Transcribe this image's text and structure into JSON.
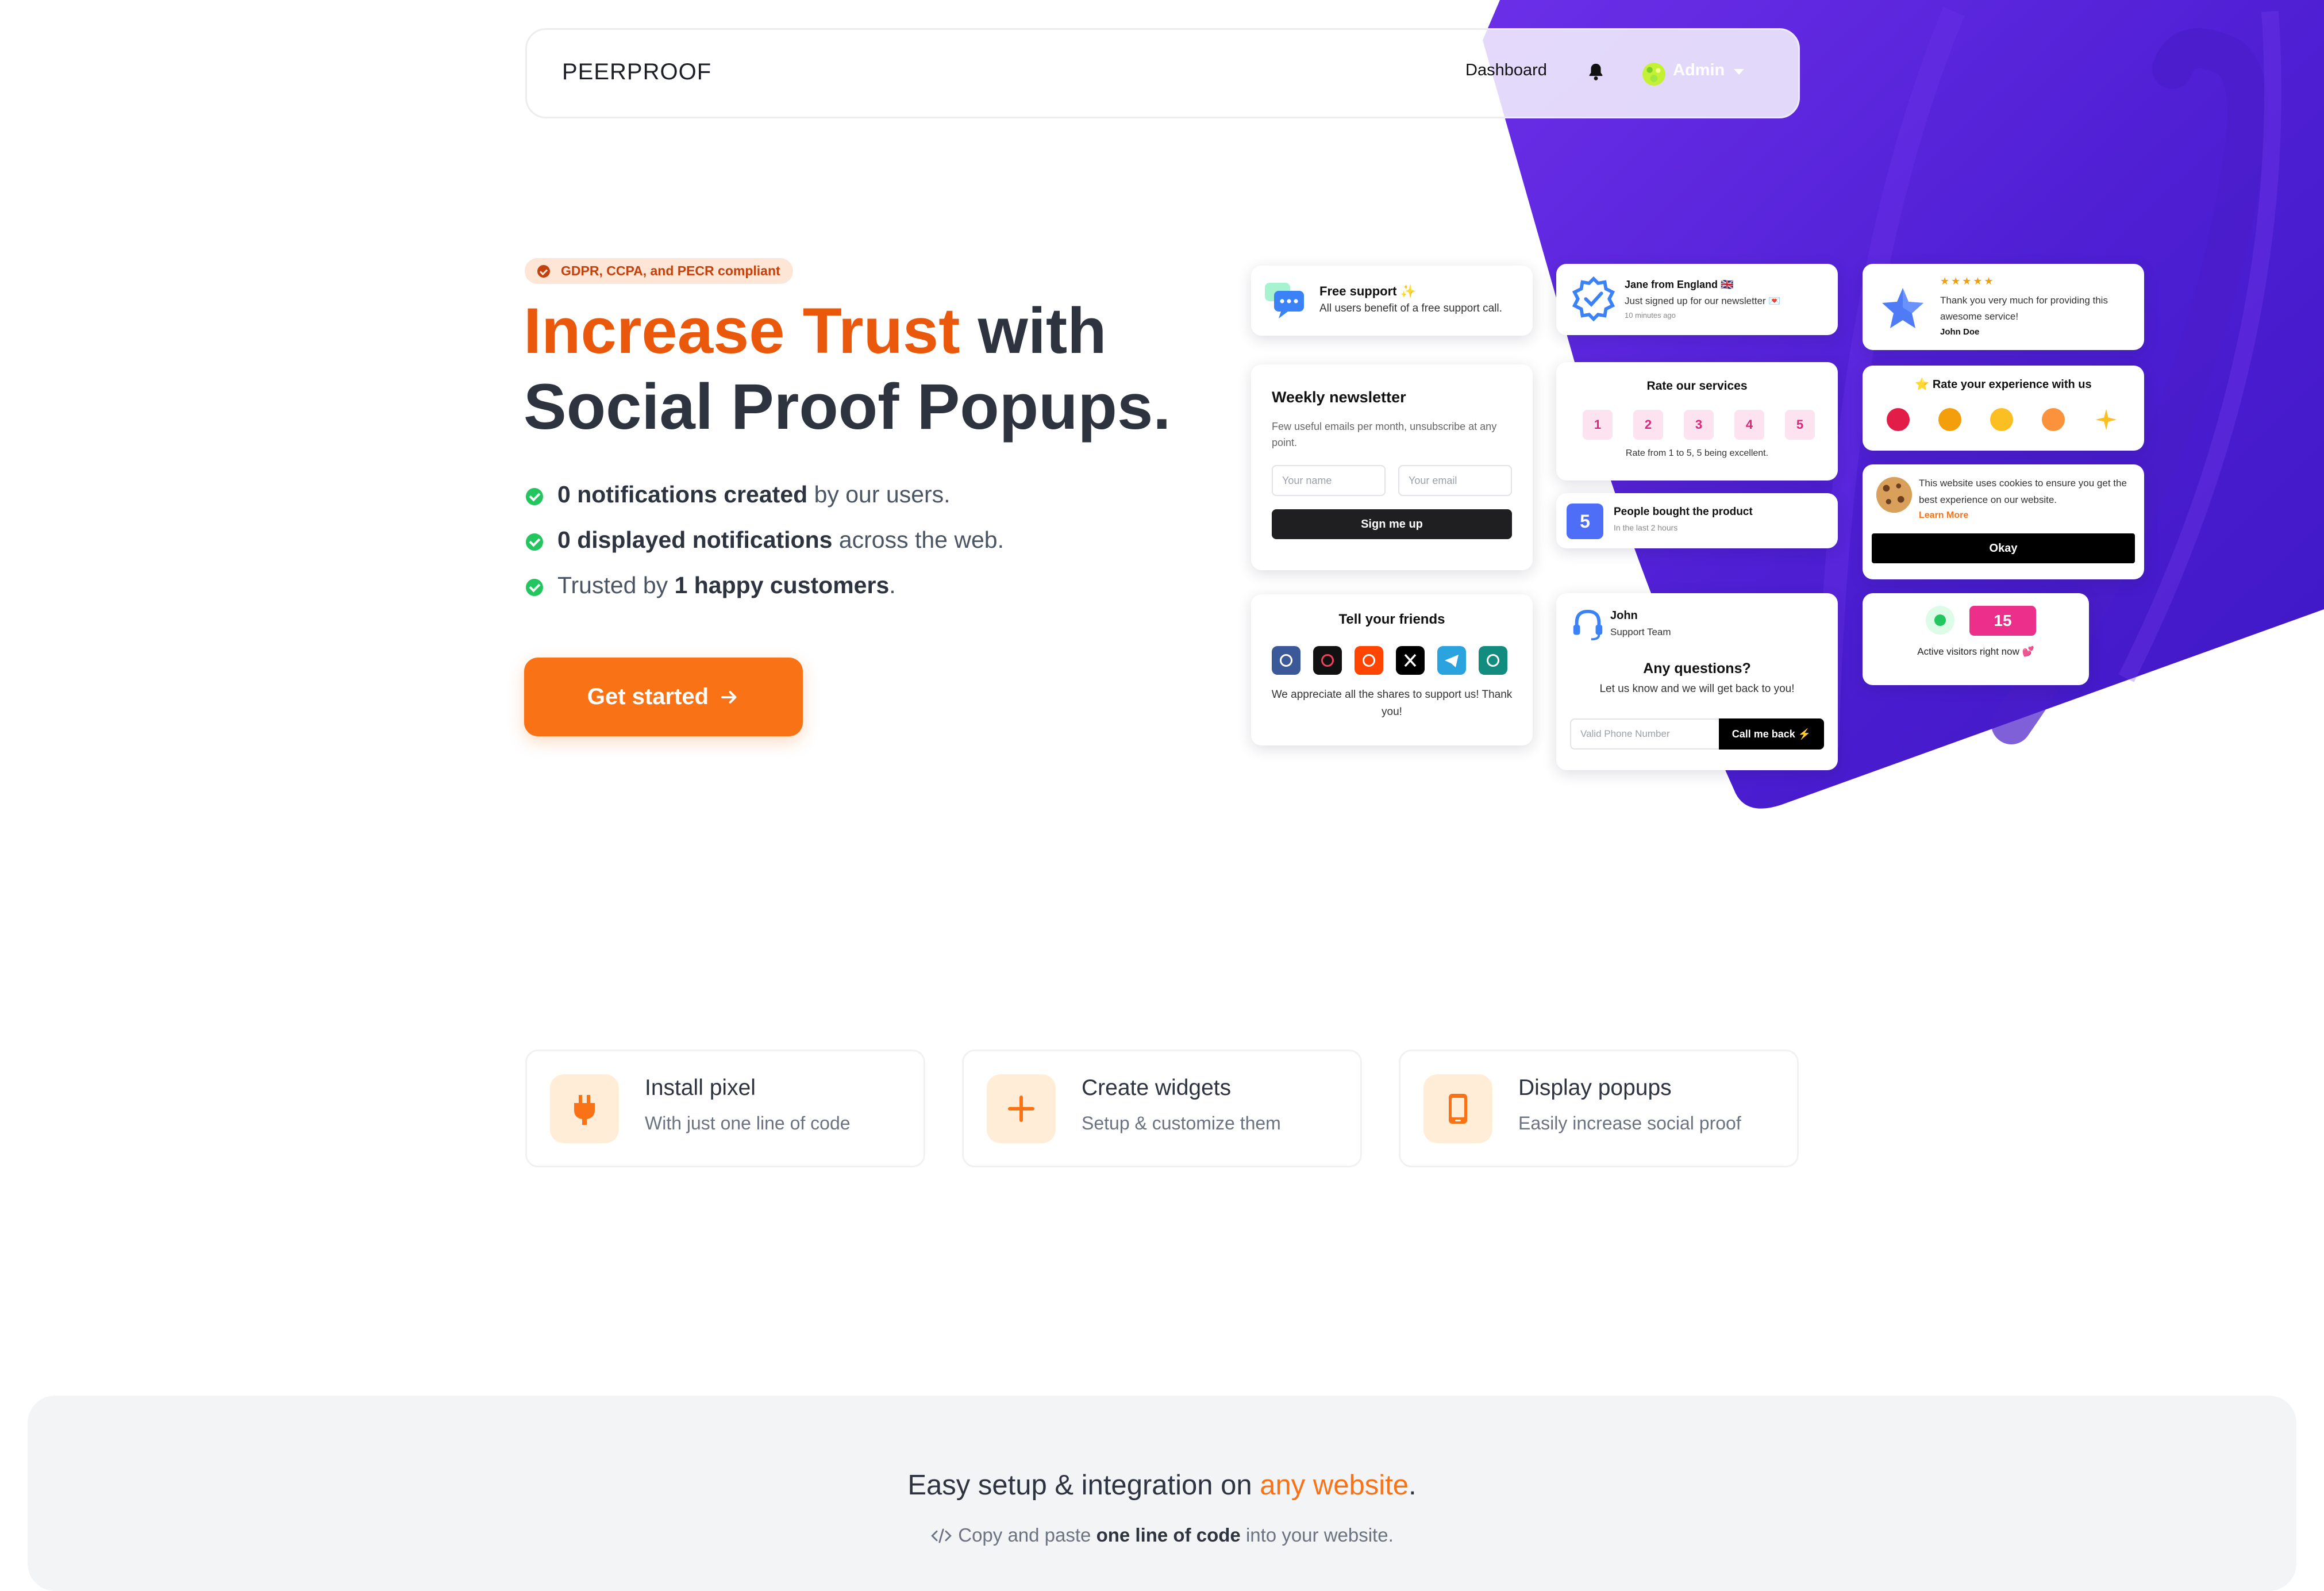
{
  "nav": {
    "brand": "PEERPROOF",
    "dashboard": "Dashboard",
    "admin": "Admin"
  },
  "hero": {
    "badge": "GDPR, CCPA, and PECR compliant",
    "title_accent": "Increase Trust",
    "title_rest_1": " with",
    "title_line_2": "Social Proof Popups.",
    "features": [
      {
        "bold": "0 notifications created",
        "rest": " by our users."
      },
      {
        "bold": "0 displayed notifications",
        "rest": " across the web."
      },
      {
        "pre": "Trusted by ",
        "bold": "1 happy customers",
        "rest": "."
      }
    ],
    "cta": "Get started"
  },
  "popups": {
    "free_support": {
      "title": "Free support ✨",
      "text": "All users benefit of a free support call."
    },
    "newsletter": {
      "title": "Weekly newsletter",
      "text": "Few useful emails per month, unsubscribe at any point.",
      "name_placeholder": "Your name",
      "email_placeholder": "Your email",
      "button": "Sign me up"
    },
    "tell_friends": {
      "title": "Tell your friends",
      "text": "We appreciate all the shares to support us! Thank you!"
    },
    "jane": {
      "title": "Jane from England 🇬🇧",
      "text": "Just signed up for our newsletter 💌",
      "time": "10 minutes ago"
    },
    "rate_services": {
      "title": "Rate our services",
      "options": [
        "1",
        "2",
        "3",
        "4",
        "5"
      ],
      "text": "Rate from 1 to 5, 5 being excellent."
    },
    "bought": {
      "count": "5",
      "title": "People bought the product",
      "time": "In the last 2 hours"
    },
    "support": {
      "name": "John",
      "role": "Support Team",
      "title": "Any questions?",
      "text": "Let us know and we will get back to you!",
      "placeholder": "Valid Phone Number",
      "button": "Call me back ⚡"
    },
    "review": {
      "stars": "★★★★★",
      "text": "Thank you very much for providing this awesome service!",
      "author": "John Doe"
    },
    "rate_experience": {
      "title": "⭐ Rate your experience with us"
    },
    "cookies": {
      "text": "This website uses cookies to ensure you get the best experience on our website.",
      "link": "Learn More",
      "button": "Okay"
    },
    "visitors": {
      "count": "15",
      "text": "Active visitors right now 💕"
    }
  },
  "steps": [
    {
      "title": "Install pixel",
      "subtitle": "With just one line of code",
      "icon": "plug-icon"
    },
    {
      "title": "Create widgets",
      "subtitle": "Setup & customize them",
      "icon": "plus-icon"
    },
    {
      "title": "Display popups",
      "subtitle": "Easily increase social proof",
      "icon": "mobile-icon"
    }
  ],
  "integration": {
    "title_pre": "Easy setup & integration on ",
    "title_accent": "any website",
    "title_post": ".",
    "sub_pre": "Copy and paste ",
    "sub_bold": "one line of code",
    "sub_post": " into your website."
  },
  "colors": {
    "accent": "#f97316",
    "accent_dark": "#ea580c",
    "purple": "#5b21d6",
    "text": "#2d333f"
  }
}
